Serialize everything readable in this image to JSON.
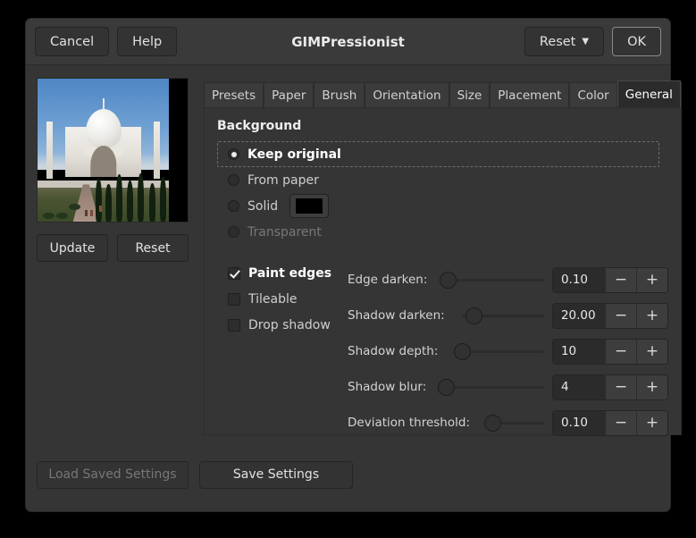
{
  "window": {
    "title": "GIMPressionist"
  },
  "header": {
    "cancel_label": "Cancel",
    "help_label": "Help",
    "reset_label": "Reset",
    "reset_chevron": "chevron-down-icon",
    "ok_label": "OK"
  },
  "preview": {
    "image_alt": "taj-mahal-preview",
    "update_label": "Update",
    "reset_label": "Reset"
  },
  "tabs": [
    {
      "label": "Presets",
      "active": false
    },
    {
      "label": "Paper",
      "active": false
    },
    {
      "label": "Brush",
      "active": false
    },
    {
      "label": "Orientation",
      "active": false
    },
    {
      "label": "Size",
      "active": false
    },
    {
      "label": "Placement",
      "active": false
    },
    {
      "label": "Color",
      "active": false
    },
    {
      "label": "General",
      "active": true
    }
  ],
  "panel": {
    "background_title": "Background",
    "radios": [
      {
        "label": "Keep original",
        "selected": true,
        "disabled": false,
        "focused": true
      },
      {
        "label": "From paper",
        "selected": false,
        "disabled": false,
        "focused": false
      },
      {
        "label": "Solid",
        "selected": false,
        "disabled": false,
        "focused": false
      },
      {
        "label": "Transparent",
        "selected": false,
        "disabled": true,
        "focused": false
      }
    ],
    "solid_color": "#000000",
    "checkboxes": [
      {
        "label": "Paint edges",
        "checked": true
      },
      {
        "label": "Tileable",
        "checked": false
      },
      {
        "label": "Drop shadow",
        "checked": false
      }
    ],
    "sliders": [
      {
        "label": "Edge darken:",
        "value": "0.10",
        "fill_percent": 4,
        "minus": "−",
        "plus": "+"
      },
      {
        "label": "Shadow darken:",
        "value": "20.00",
        "fill_percent": 14,
        "minus": "−",
        "plus": "+"
      },
      {
        "label": "Shadow depth:",
        "value": "10",
        "fill_percent": 8,
        "minus": "−",
        "plus": "+"
      },
      {
        "label": "Shadow blur:",
        "value": "4",
        "fill_percent": 3,
        "minus": "−",
        "plus": "+"
      },
      {
        "label": "Deviation threshold:",
        "value": "0.10",
        "fill_percent": 10,
        "minus": "−",
        "plus": "+"
      }
    ]
  },
  "footer": {
    "load_label": "Load Saved Settings",
    "load_disabled": true,
    "save_label": "Save Settings"
  }
}
